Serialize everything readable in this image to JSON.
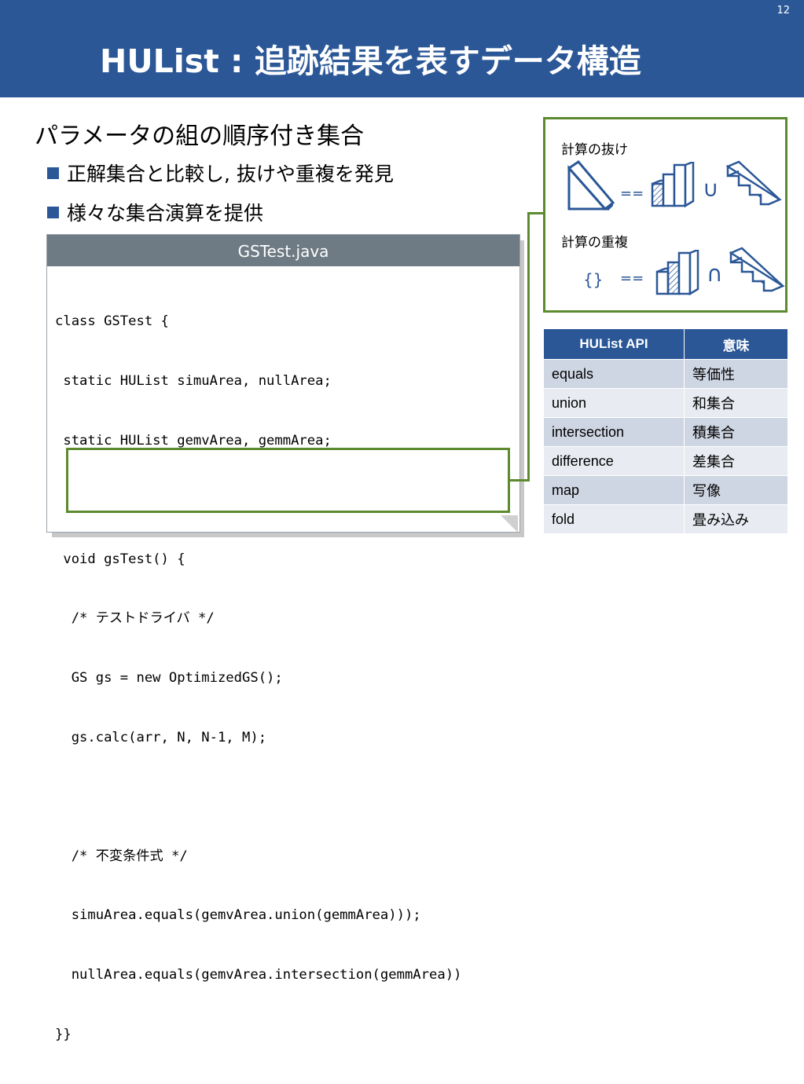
{
  "slide": {
    "number": "12",
    "title": "HUList : 追跡結果を表すデータ構造"
  },
  "bullets": {
    "main": "パラメータの組の順序付き集合",
    "sub": [
      "正解集合と比較し, 抜けや重複を発見",
      "様々な集合演算を提供"
    ]
  },
  "code": {
    "filename": "GSTest.java",
    "lines": [
      "class GSTest {",
      " static HUList simuArea, nullArea;",
      " static HUList gemvArea, gemmArea;",
      "",
      " void gsTest() {",
      "  /* テストドライバ */",
      "  GS gs = new OptimizedGS();",
      "  gs.calc(arr, N, N-1, M);",
      "",
      "  /* 不変条件式 */",
      "  simuArea.equals(gemvArea.union(gemmArea)));",
      "  nullArea.equals(gemvArea.intersection(gemmArea))",
      "}}"
    ]
  },
  "illustration": {
    "label_missing": "計算の抜け",
    "label_duplicate": "計算の重複",
    "equals_op": "==",
    "union_op": "∪",
    "intersection_op": "∩",
    "empty_set": "{}"
  },
  "table": {
    "headers": [
      "HUList API",
      "意味"
    ],
    "rows": [
      [
        "equals",
        "等価性"
      ],
      [
        "union",
        "和集合"
      ],
      [
        "intersection",
        "積集合"
      ],
      [
        "difference",
        "差集合"
      ],
      [
        "map",
        "写像"
      ],
      [
        "fold",
        "畳み込み"
      ]
    ]
  },
  "colors": {
    "header_blue": "#2b5797",
    "accent_green": "#5c8a2e",
    "code_header_gray": "#6e7b84"
  }
}
